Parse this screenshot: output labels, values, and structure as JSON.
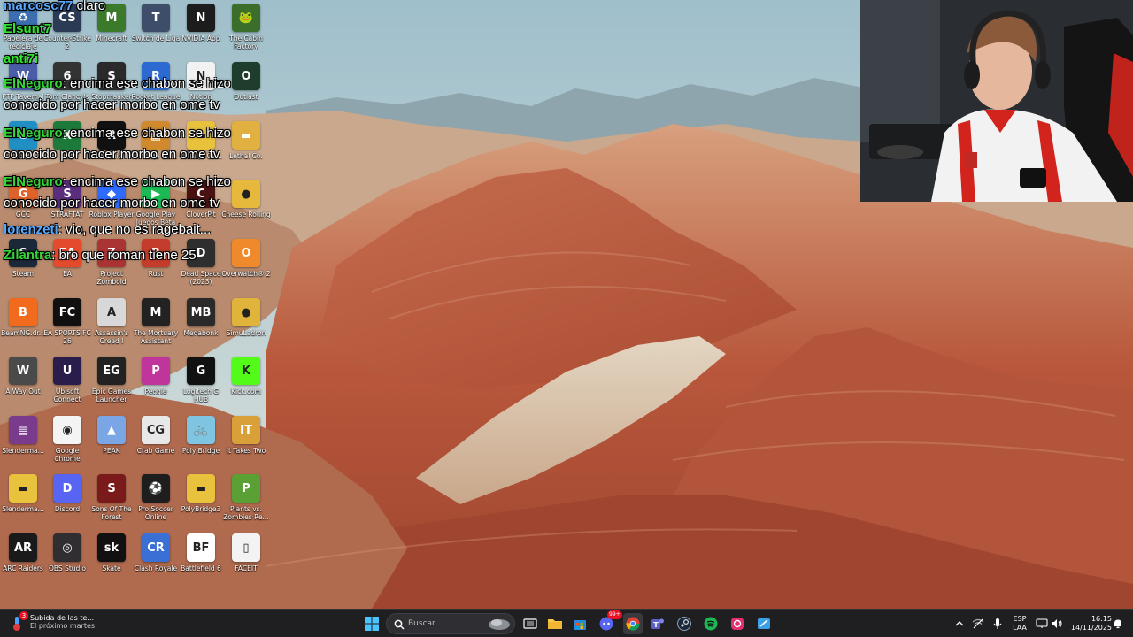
{
  "desktop_icons": [
    {
      "label": "Papelera de reciclaje",
      "color": "#3c6fb0",
      "glyph": "♻"
    },
    {
      "label": "Counter-Strike 2",
      "color": "#2b3a55",
      "glyph": "CS"
    },
    {
      "label": "Minecraft",
      "color": "#3b7a2a",
      "glyph": "M"
    },
    {
      "label": "Switch de Liga",
      "color": "#3e4e6a",
      "glyph": "T"
    },
    {
      "label": "NVIDIA App",
      "color": "#1c1c1c",
      "glyph": "N"
    },
    {
      "label": "The Cabin Factory",
      "color": "#3b6e2a",
      "glyph": "🐸"
    },
    {
      "label": "PTP Tavernal",
      "color": "#4b5ca8",
      "glyph": "W"
    },
    {
      "label": "Tom Clancy's",
      "color": "#333",
      "glyph": "6"
    },
    {
      "label": "Stopmaaker",
      "color": "#2a2a2a",
      "glyph": "S"
    },
    {
      "label": "Rocket League",
      "color": "#2c6ad1",
      "glyph": "R"
    },
    {
      "label": "Notion",
      "color": "#f2f2f2",
      "glyph": "N"
    },
    {
      "label": "Outlast",
      "color": "#1f3d2c",
      "glyph": "O"
    },
    {
      "label": "Edge",
      "color": "#1f8fc4",
      "glyph": "e"
    },
    {
      "label": "App",
      "color": "#1e7a3a",
      "glyph": "X"
    },
    {
      "label": "Studio",
      "color": "#111",
      "glyph": "R"
    },
    {
      "label": "vintage Ga...",
      "color": "#d08a2d",
      "glyph": "▦"
    },
    {
      "label": "vintage Ga...",
      "color": "#e8c23d",
      "glyph": "▬"
    },
    {
      "label": "Lethal Co.",
      "color": "#e0b040",
      "glyph": "▬"
    },
    {
      "label": "GCC",
      "color": "#e0622b",
      "glyph": "G"
    },
    {
      "label": "STRAFTAT",
      "color": "#5a2e7c",
      "glyph": "S"
    },
    {
      "label": "Roblox Player",
      "color": "#2f6bff",
      "glyph": "◆"
    },
    {
      "label": "Google Play Juegos Beta",
      "color": "#1db954",
      "glyph": "▶"
    },
    {
      "label": "CloverPit",
      "color": "#4a1111",
      "glyph": "C"
    },
    {
      "label": "Cheese Rolling",
      "color": "#e6b93c",
      "glyph": "●"
    },
    {
      "label": "Steam",
      "color": "#1b2838",
      "glyph": "S"
    },
    {
      "label": "EA",
      "color": "#e44a2c",
      "glyph": "EA"
    },
    {
      "label": "Project Zomboid",
      "color": "#a33",
      "glyph": "Z"
    },
    {
      "label": "Rust",
      "color": "#c43c2b",
      "glyph": "R"
    },
    {
      "label": "Dead Space (2023)",
      "color": "#2e2e2e",
      "glyph": "D"
    },
    {
      "label": "Overwatch® 2",
      "color": "#ef8a2c",
      "glyph": "O"
    },
    {
      "label": "BeamNG.dr...",
      "color": "#f26a1c",
      "glyph": "B"
    },
    {
      "label": "EA SPORTS FC 26",
      "color": "#101010",
      "glyph": "FC"
    },
    {
      "label": "Assassin's Creed I",
      "color": "#d8d8d8",
      "glyph": "A"
    },
    {
      "label": "The Mortuary Assistant",
      "color": "#222",
      "glyph": "M"
    },
    {
      "label": "Megabonk",
      "color": "#2a2a2a",
      "glyph": "MB"
    },
    {
      "label": "SimuLadron",
      "color": "#e0b43a",
      "glyph": "●"
    },
    {
      "label": "A Way Out",
      "color": "#4a4a4a",
      "glyph": "W"
    },
    {
      "label": "Ubisoft Connect",
      "color": "#2b1d4b",
      "glyph": "U"
    },
    {
      "label": "Epic Games Launcher",
      "color": "#222",
      "glyph": "EG"
    },
    {
      "label": "Peggle",
      "color": "#c0359c",
      "glyph": "P"
    },
    {
      "label": "Logitech G HUB",
      "color": "#111",
      "glyph": "G"
    },
    {
      "label": "Kick.com",
      "color": "#53fc18",
      "glyph": "K"
    },
    {
      "label": "Slenderma...",
      "color": "#7a3b8c",
      "glyph": "▤"
    },
    {
      "label": "Google Chrome",
      "color": "#f4f4f4",
      "glyph": "◉"
    },
    {
      "label": "PEAK",
      "color": "#7aa6e6",
      "glyph": "▲"
    },
    {
      "label": "Crab Game",
      "color": "#e8e8e8",
      "glyph": "CG"
    },
    {
      "label": "Poly Bridge",
      "color": "#7fc4e0",
      "glyph": "🚲"
    },
    {
      "label": "It Takes Two",
      "color": "#d9a03a",
      "glyph": "IT"
    },
    {
      "label": "Slenderma...",
      "color": "#e8c23d",
      "glyph": "▬"
    },
    {
      "label": "Discord",
      "color": "#5865f2",
      "glyph": "D"
    },
    {
      "label": "Sons Of The Forest",
      "color": "#7a1a1a",
      "glyph": "S"
    },
    {
      "label": "Pro Soccer Online",
      "color": "#1e1e1e",
      "glyph": "⚽"
    },
    {
      "label": "PolyBridge3",
      "color": "#e8c23d",
      "glyph": "▬"
    },
    {
      "label": "Plants vs. Zombies Re...",
      "color": "#5aa035",
      "glyph": "P"
    },
    {
      "label": "ARC Raiders",
      "color": "#1a1a1a",
      "glyph": "AR"
    },
    {
      "label": "OBS Studio",
      "color": "#302e31",
      "glyph": "◎"
    },
    {
      "label": "Skate",
      "color": "#111",
      "glyph": "sk"
    },
    {
      "label": "Clash Royale",
      "color": "#3a6fd6",
      "glyph": "CR"
    },
    {
      "label": "Battlefield 6",
      "color": "#fff",
      "glyph": "BF"
    },
    {
      "label": "FACEIT",
      "color": "#f3f3f3",
      "glyph": "▯"
    }
  ],
  "chat": [
    {
      "user": "marcosc77",
      "text": " claro",
      "color": "blue"
    },
    {
      "user": "Elsunt7",
      "text": "",
      "color": "lime"
    },
    {
      "user": "anti7i",
      "text": "",
      "color": "lime"
    },
    {
      "user": "ElNeguro",
      "text": ": encima ese chabon se hizo",
      "color": "green"
    },
    {
      "user": "",
      "text": "conocido por hacer morbo en ome tv",
      "color": "green"
    },
    {
      "user": "ElNeguro",
      "text": ": encima ese chabon se hizo",
      "color": "green"
    },
    {
      "user": "",
      "text": "conocido por hacer morbo en ome tv",
      "color": "green"
    },
    {
      "user": "ElNeguro",
      "text": ": encima ese chabon se hizo",
      "color": "green"
    },
    {
      "user": "",
      "text": "conocido por hacer morbo en ome tv",
      "color": "green"
    },
    {
      "user": "lorenzeti",
      "text": ": vio, que no es ragebait...",
      "color": "blue"
    },
    {
      "user": "Zilantra",
      "text": ": bro que roman tiene 25",
      "color": "green"
    }
  ],
  "taskbar": {
    "notification_title": "Subida de las te...",
    "notification_sub": "El próximo martes",
    "notification_badge": "3",
    "search_placeholder": "Buscar",
    "lang_top": "ESP",
    "lang_bottom": "LAA",
    "time": "16:15",
    "date": "14/11/2025",
    "discord_badge": "99+"
  }
}
